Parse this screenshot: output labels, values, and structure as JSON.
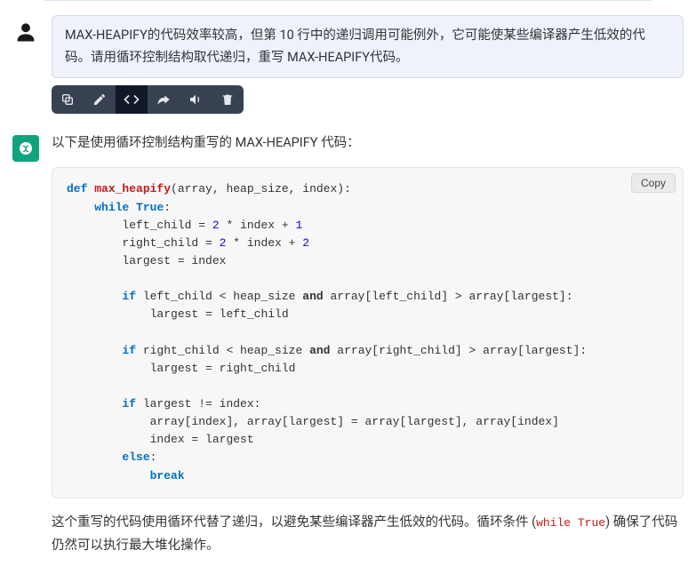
{
  "user_message": {
    "text": "MAX-HEAPIFY的代码效率较高，但第 10 行中的递归调用可能例外，它可能使某些编译器产生低效的代码。请用循环控制结构取代递归，重写 MAX-HEAPIFY代码。"
  },
  "toolbar": {
    "copy": "copy-icon",
    "edit": "edit-icon",
    "code": "code-icon",
    "share": "share-icon",
    "volume": "volume-icon",
    "delete": "delete-icon"
  },
  "bot_message": {
    "intro": "以下是使用循环控制结构重写的 MAX-HEAPIFY 代码：",
    "copy_label": "Copy",
    "outro_prefix": "这个重写的代码使用循环代替了递归，以避免某些编译器产生低效的代码。循环条件 (",
    "outro_code": "while True",
    "outro_suffix": ") 确保了代码仍然可以执行最大堆化操作。"
  },
  "code": {
    "kw_def": "def",
    "fn_name": "max_heapify",
    "sig_tail": "(array, heap_size, index):",
    "kw_while": "while",
    "kw_True": "True",
    "colon": ":",
    "l_left": "left_child = ",
    "n2a": "2",
    "l_left_tail": " * index + ",
    "n1": "1",
    "l_right": "right_child = ",
    "n2b": "2",
    "l_right_tail": " * index + ",
    "n2c": "2",
    "l_largest_init": "largest = index",
    "kw_if1": "if",
    "cond1a": " left_child < heap_size ",
    "kw_and1": "and",
    "cond1b": " array[left_child] > array[largest]:",
    "assign1": "largest = left_child",
    "kw_if2": "if",
    "cond2a": " right_child < heap_size ",
    "kw_and2": "and",
    "cond2b": " array[right_child] > array[largest]:",
    "assign2": "largest = right_child",
    "kw_if3": "if",
    "cond3": " largest != index:",
    "swap": "array[index], array[largest] = array[largest], array[index]",
    "idx_assign": "index = largest",
    "kw_else": "else",
    "kw_break": "break"
  }
}
